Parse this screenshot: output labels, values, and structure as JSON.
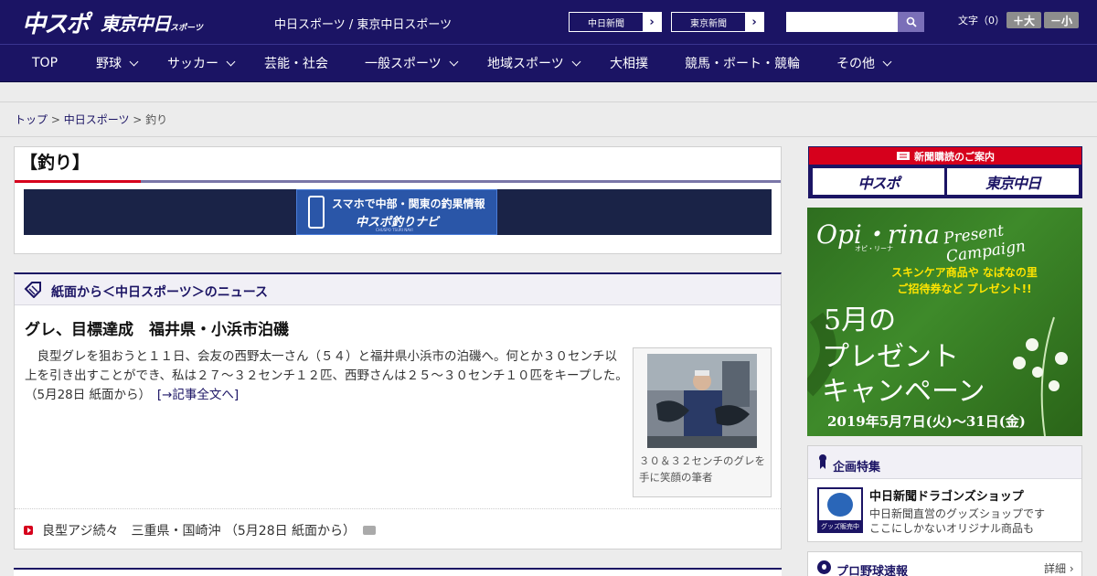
{
  "header": {
    "logo_chuspo": "中スポ",
    "logo_tokyo": "東京中日",
    "logo_tokyo_small": "スポーツ",
    "sites": "中日スポーツ / 東京中日スポーツ",
    "paper1": "中日新聞",
    "paper2": "東京新聞",
    "search_placeholder": "",
    "font_label": "文字（0）",
    "font_big": "＋大",
    "font_small": "－小"
  },
  "nav": [
    {
      "label": "TOP",
      "caret": false
    },
    {
      "label": "野球",
      "caret": true
    },
    {
      "label": "サッカー",
      "caret": true
    },
    {
      "label": "芸能・社会",
      "caret": false
    },
    {
      "label": "一般スポーツ",
      "caret": true
    },
    {
      "label": "地域スポーツ",
      "caret": true
    },
    {
      "label": "大相撲",
      "caret": false
    },
    {
      "label": "競馬・ボート・競輪",
      "caret": false
    },
    {
      "label": "その他",
      "caret": true
    }
  ],
  "breadcrumb": {
    "top": "トップ",
    "sep1": " > ",
    "chunichi": "中日スポーツ",
    "sep2": " > ",
    "current": "釣り"
  },
  "category": {
    "title": "【釣り】",
    "banner_line1": "スマホで中部・関東の釣果情報",
    "banner_line2": "中スポ釣りナビ",
    "banner_line3": "CHUSPO TSURI NAVI"
  },
  "news": {
    "section_title": "紙面から＜中日スポーツ＞のニュース",
    "headline": "グレ、目標達成　福井県・小浜市泊磯",
    "body": "良型グレを狙おうと１１日、会友の西野太一さん（５４）と福井県小浜市の泊磯へ。何とか３０センチ以上を引き出すことができ、私は２７～３２センチ１２匹、西野さんは２５～３０センチ１０匹をキープした。（5月28日 紙面から）　",
    "more_link": "[→記事全文へ]",
    "photo_caption": "３０＆３２センチのグレを手に笑顔の筆者",
    "sub_item": "良型アジ続々　三重県・国崎沖 （5月28日 紙面から）"
  },
  "sidebar": {
    "subscribe_head": "新聞購読のご案内",
    "subscribe_btn1": "中スポ",
    "subscribe_btn2": "東京中日",
    "promo_brand": "Opi・rina",
    "promo_brand_sub": "オピ・リーナ",
    "promo_campaign": "Present Campaign",
    "promo_yellow": "スキンケア商品や なばなの里ご招待券など プレゼント!!",
    "promo_l1": "5月の",
    "promo_l2": "プレゼント",
    "promo_l3": "キャンペーン",
    "promo_date": "2019年5月7日(火)～31日(金)",
    "feature_title": "企画特集",
    "feature_img_label": "グッズ販売中",
    "feature_name": "中日新聞ドラゴンズショップ",
    "feature_desc1": "中日新聞直営のグッズショップです",
    "feature_desc2": "ここにしかないオリジナル商品も",
    "baseball_title": "プロ野球速報",
    "baseball_more": "詳細 ›"
  },
  "colors": {
    "navy": "#1b1464",
    "accent_red": "#d6001c"
  }
}
